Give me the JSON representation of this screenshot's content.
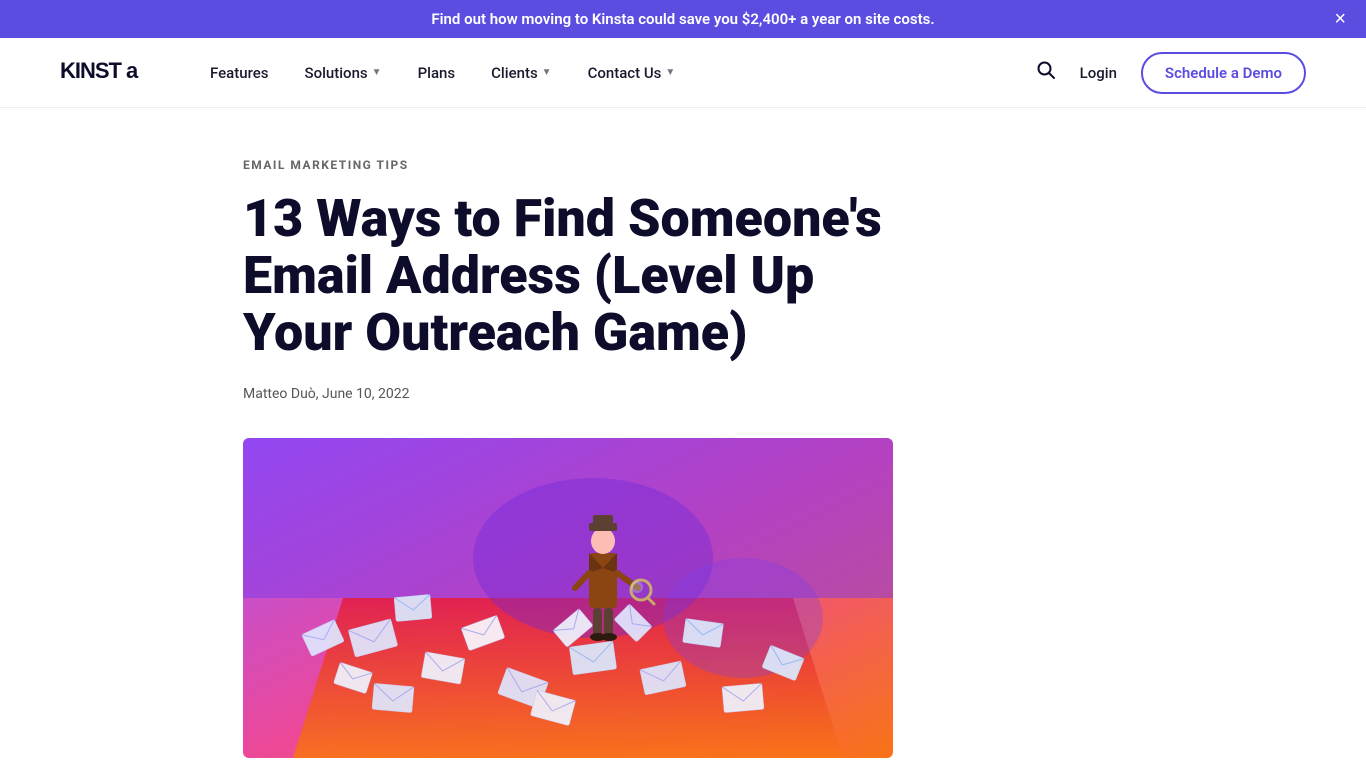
{
  "banner": {
    "text": "Find out how moving to Kinsta could save you $2,400+ a year on site costs.",
    "close_label": "×"
  },
  "nav": {
    "logo": "KINSTa",
    "links": [
      {
        "label": "Features",
        "has_arrow": false
      },
      {
        "label": "Solutions",
        "has_arrow": true
      },
      {
        "label": "Plans",
        "has_arrow": false
      },
      {
        "label": "Clients",
        "has_arrow": true
      },
      {
        "label": "Contact Us",
        "has_arrow": true
      }
    ],
    "search_label": "🔍",
    "login_label": "Login",
    "cta_label": "Schedule a Demo"
  },
  "article": {
    "category": "EMAIL MARKETING TIPS",
    "title": "13 Ways to Find Someone's Email Address (Level Up Your Outreach Game)",
    "author": "Matteo Duò",
    "date": "June 10, 2022",
    "meta": "Matteo Duò, June 10, 2022"
  },
  "colors": {
    "banner_bg": "#5b4de0",
    "accent": "#5b4de0",
    "title_color": "#0d0d2b"
  }
}
